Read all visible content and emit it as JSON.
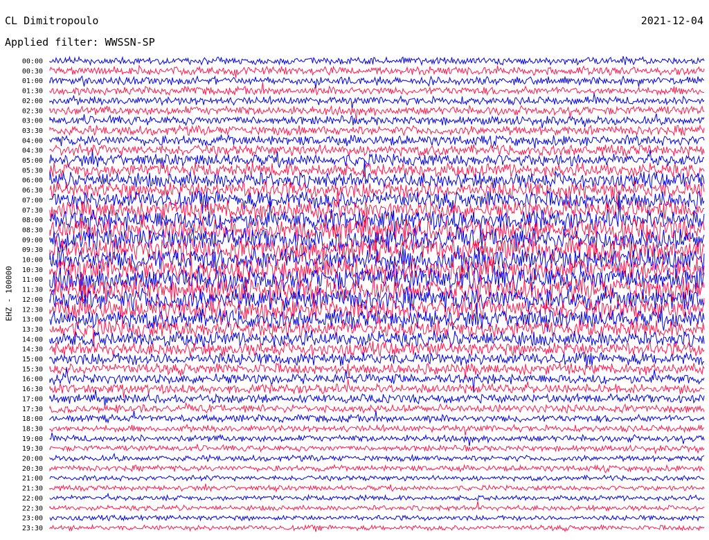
{
  "header": {
    "station": "CL Dimitropoulo",
    "filter": "Applied filter: WWSSN-SP",
    "date": "2021-12-04"
  },
  "colors": {
    "trace_a": "#0000e6",
    "trace_b": "#ff1a4d",
    "background": "#ffffff"
  },
  "chart_data": {
    "type": "line",
    "ylabel": "EHZ - 100000",
    "row_labels": [
      "00:00",
      "00:30",
      "01:00",
      "01:30",
      "02:00",
      "02:30",
      "03:00",
      "03:30",
      "04:00",
      "04:30",
      "05:00",
      "05:30",
      "06:00",
      "06:30",
      "07:00",
      "07:30",
      "08:00",
      "08:30",
      "09:00",
      "09:30",
      "10:00",
      "10:30",
      "11:00",
      "11:30",
      "12:00",
      "12:30",
      "13:00",
      "13:30",
      "14:00",
      "14:30",
      "15:00",
      "15:30",
      "16:00",
      "16:30",
      "17:00",
      "17:30",
      "18:00",
      "18:30",
      "19:00",
      "19:30",
      "20:00",
      "20:30",
      "21:00",
      "21:30",
      "22:00",
      "22:30",
      "23:00",
      "23:30"
    ],
    "row_colors": [
      "trace_a",
      "trace_b"
    ],
    "relative_amplitude": [
      1.0,
      1.1,
      1.1,
      1.1,
      1.1,
      1.2,
      1.2,
      1.3,
      1.4,
      1.5,
      1.7,
      1.9,
      2.1,
      2.3,
      2.4,
      2.6,
      2.8,
      3.0,
      3.1,
      3.2,
      3.3,
      3.3,
      3.3,
      3.2,
      3.1,
      2.9,
      2.6,
      2.4,
      2.1,
      1.9,
      1.7,
      1.5,
      1.4,
      1.3,
      1.2,
      1.1,
      1.0,
      0.9,
      0.9,
      0.8,
      0.8,
      0.8,
      0.7,
      0.7,
      0.7,
      0.7,
      0.7,
      0.7
    ]
  }
}
